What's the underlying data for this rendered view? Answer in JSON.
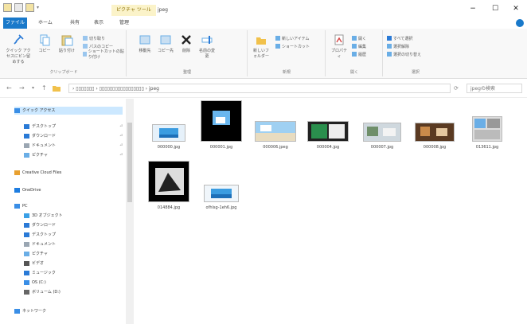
{
  "title_bar": {
    "context_tab": "ピクチャ ツール",
    "title": "jpeg",
    "minimize": "−",
    "maximize": "☐",
    "close": "✕"
  },
  "tabs": [
    "ファイル",
    "ホーム",
    "共有",
    "表示",
    "管理"
  ],
  "ribbon": {
    "groups": [
      "クリップボード",
      "整理",
      "新規",
      "開く",
      "選択"
    ],
    "quick_access_label": "クイック アクセスにピン留めする",
    "copy": "コピー",
    "paste": "貼り付け",
    "cut": "切り取り",
    "copy_path": "パスのコピー",
    "paste_shortcut": "ショートカットの貼り付け",
    "move_to": "移動先",
    "copy_to": "コピー先",
    "delete": "削除",
    "rename": "名前の変更",
    "new_folder": "新しいフォルダー",
    "new_item": "新しいアイテム",
    "easy_access": "ショートカット",
    "properties": "プロパティ",
    "open": "開く",
    "edit": "編集",
    "history": "履歴",
    "select_all": "すべて選択",
    "select_none": "選択解除",
    "invert_selection": "選択の切り替え"
  },
  "address": {
    "path": "› ▯▯▯▯▯▯▯ › ▯▯▯▯▯▯▯▯▯▯▯▯▯▯▯▯▯ › jpeg",
    "search_placeholder": "jpegの検索"
  },
  "nav": [
    {
      "label": "クイック アクセス",
      "color": "#3a8ee6",
      "selected": true,
      "indent": 0
    },
    {
      "label": "デスクトップ",
      "color": "#2a7ad6",
      "indent": 1,
      "pin": true
    },
    {
      "label": "ダウンロード",
      "color": "#2a7ad6",
      "indent": 1,
      "pin": true
    },
    {
      "label": "ドキュメント",
      "color": "#9aa6b2",
      "indent": 1,
      "pin": true
    },
    {
      "label": "ピクチャ",
      "color": "#6aaee6",
      "indent": 1,
      "pin": true
    },
    {
      "label": "Creative Cloud Files",
      "color": "#e8a030",
      "indent": 0
    },
    {
      "label": "OneDrive",
      "color": "#1e7de0",
      "indent": 0
    },
    {
      "label": "PC",
      "color": "#3a8ee6",
      "indent": 0
    },
    {
      "label": "3D オブジェクト",
      "color": "#3aa0e6",
      "indent": 1
    },
    {
      "label": "ダウンロード",
      "color": "#2a7ad6",
      "indent": 1
    },
    {
      "label": "デスクトップ",
      "color": "#2a7ad6",
      "indent": 1
    },
    {
      "label": "ドキュメント",
      "color": "#9aa6b2",
      "indent": 1
    },
    {
      "label": "ピクチャ",
      "color": "#6aaee6",
      "indent": 1
    },
    {
      "label": "ビデオ",
      "color": "#555",
      "indent": 1
    },
    {
      "label": "ミュージック",
      "color": "#2a7ad6",
      "indent": 1
    },
    {
      "label": "OS (C:)",
      "color": "#3a8ee6",
      "indent": 1
    },
    {
      "label": "ボリューム (D:)",
      "color": "#666",
      "indent": 1
    },
    {
      "label": "ネットワーク",
      "color": "#3a8ee6",
      "indent": 0
    }
  ],
  "files": [
    {
      "name": "000000.jpg",
      "kind": "sky"
    },
    {
      "name": "000001.jpg",
      "kind": "dark",
      "selected": true
    },
    {
      "name": "000006.jpeg",
      "kind": "beach"
    },
    {
      "name": "000004.jpg",
      "kind": "screen"
    },
    {
      "name": "000007.jpg",
      "kind": "room"
    },
    {
      "name": "000008.jpg",
      "kind": "brown"
    },
    {
      "name": "013611.jpg",
      "kind": "collage"
    },
    {
      "name": "014884.jpg",
      "kind": "bw",
      "selected": true
    },
    {
      "name": "ofhlsg-1eh6.jpg",
      "kind": "sky2"
    }
  ]
}
